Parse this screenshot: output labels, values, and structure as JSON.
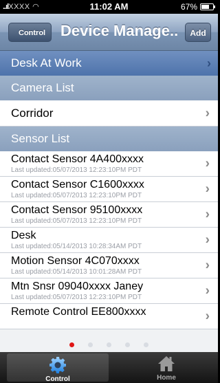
{
  "status": {
    "carrier": "XXXX",
    "time": "11:02 AM",
    "battery": "67%",
    "battery_level": 0.67
  },
  "nav": {
    "back_label": "Control",
    "title": "Device Manage...",
    "add_label": "Add"
  },
  "location": "Desk At Work",
  "camera_section": "Camera List",
  "cameras": [
    {
      "name": "Corridor"
    }
  ],
  "sensor_section": "Sensor List",
  "sensors": [
    {
      "name": "Contact Sensor 4A400xxxx",
      "updated": "Last updated:05/07/2013 12:23:10PM PDT"
    },
    {
      "name": "Contact Sensor C1600xxxx",
      "updated": "Last updated:05/07/2013 12:23:10PM PDT"
    },
    {
      "name": "Contact Sensor 95100xxxx",
      "updated": "Last updated:05/07/2013 12:23:10PM PDT"
    },
    {
      "name": "Desk",
      "updated": "Last updated:05/14/2013 10:28:34AM PDT"
    },
    {
      "name": "Motion Sensor 4C070xxxx",
      "updated": "Last updated:05/14/2013 10:01:28AM PDT"
    },
    {
      "name": "Mtn Snsr 09040xxxx Janey",
      "updated": "Last updated:05/07/2013 12:23:10PM PDT"
    },
    {
      "name": "Remote Control EE800xxxx",
      "updated": ""
    }
  ],
  "page_indicator": {
    "count": 5,
    "active": 0
  },
  "tabs": [
    {
      "label": "Control",
      "icon": "gear-icon",
      "active": true
    },
    {
      "label": "Home",
      "icon": "home-icon",
      "active": false
    }
  ],
  "colors": {
    "nav": "#8fa5c2",
    "location_row": "#5a7cb3",
    "section_row": "#93a8c3",
    "active_dot": "#e01616"
  }
}
